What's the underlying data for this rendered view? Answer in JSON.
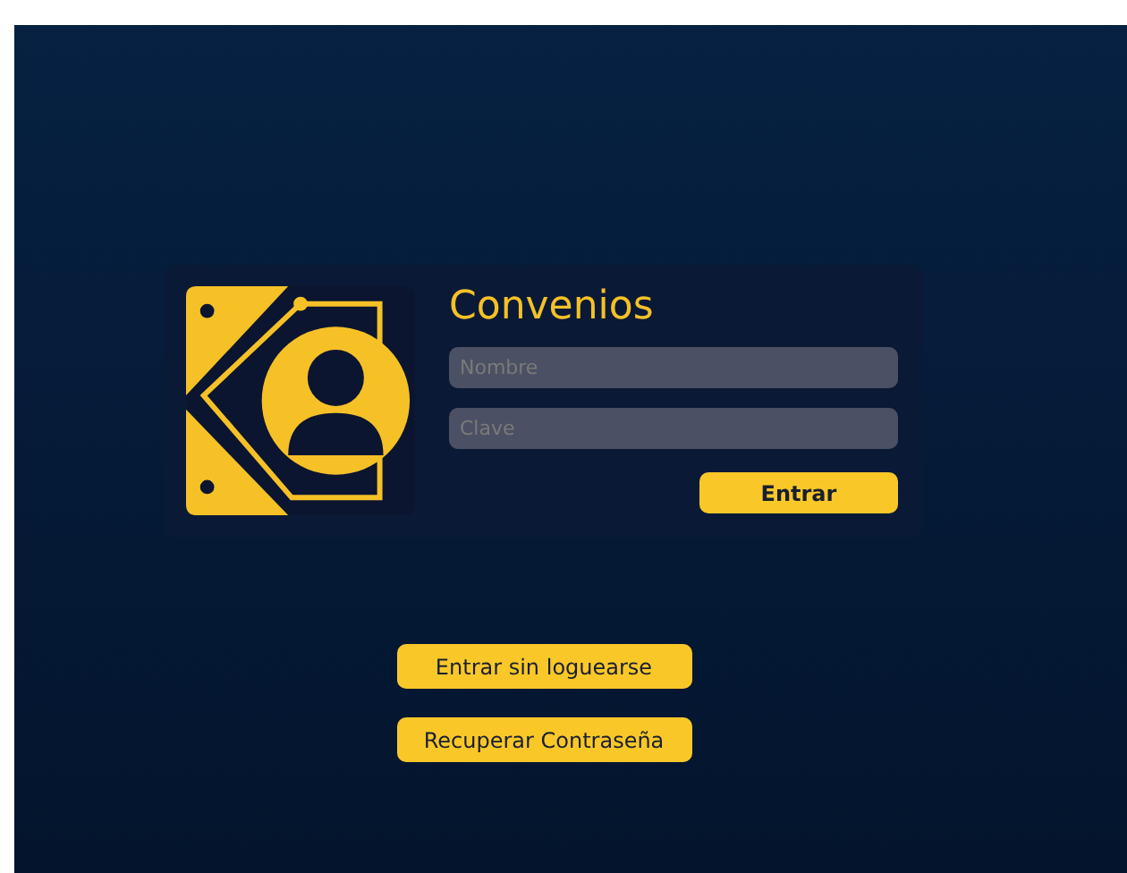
{
  "app": {
    "title": "Convenios"
  },
  "login_form": {
    "fields": [
      {
        "placeholder": "Nombre"
      },
      {
        "placeholder": "Clave"
      }
    ],
    "submit_button": "Entrar"
  },
  "actions": [
    "Entrar sin loguearse",
    "Recuperar Contraseña"
  ]
}
